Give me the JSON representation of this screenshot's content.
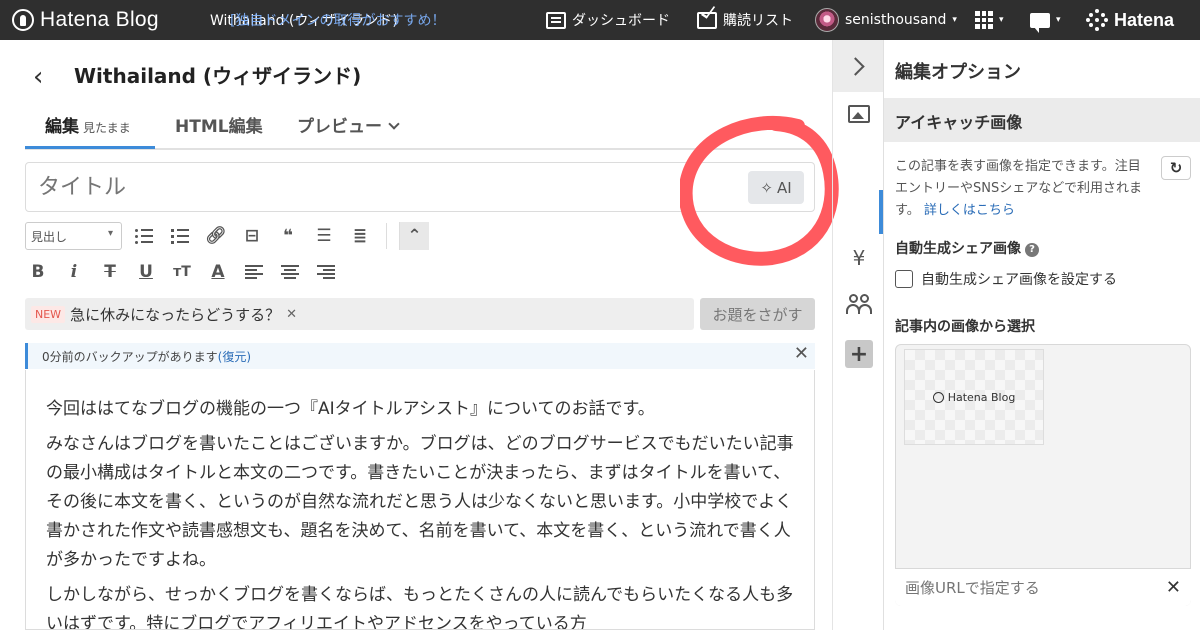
{
  "topbar": {
    "logo_text": "Hatena Blog",
    "blog_name": "Withailand (ウィザイランド)",
    "notice": "[独自ドメインの取得がおすすめ！",
    "dashboard": "ダッシュボード",
    "reading_list": "購読リスト",
    "username": "senisthousand",
    "hatena": "Hatena"
  },
  "editor": {
    "post_title": "Withailand (ウィザイランド)",
    "tabs": [
      {
        "label": "編集",
        "sub": "見たまま"
      },
      {
        "label": "HTML編集"
      },
      {
        "label": "プレビュー"
      }
    ],
    "title_placeholder": "タイトル",
    "ai_label": "AI",
    "heading_select": "見出し",
    "topic_badge": "NEW",
    "topic_text": "急に休みになったらどうする？",
    "topic_button": "お題をさがす",
    "backup_text": "0分前のバックアップがあります",
    "backup_restore": "(復元)",
    "paragraphs": [
      "今回ははてなブログの機能の一つ『AIタイトルアシスト』についてのお話です。",
      "みなさんはブログを書いたことはございますか。ブログは、どのブログサービスでもだいたい記事の最小構成はタイトルと本文の二つです。書きたいことが決まったら、まずはタイトルを書いて、その後に本文を書く、というのが自然な流れだと思う人は少なくないと思います。小中学校でよく書かされた作文や読書感想文も、題名を決めて、名前を書いて、本文を書く、という流れで書く人が多かったですよね。",
      "しかしながら、せっかくブログを書くならば、もっとたくさんの人に読んでもらいたくなる人も多いはずです。特にブログでアフィリエイトやアドセンスをやっている方"
    ]
  },
  "toolbar": {
    "icons": [
      "unordered-list-icon",
      "ordered-list-icon",
      "link-icon",
      "more-icon",
      "quote-icon",
      "table-of-contents-icon",
      "footnote-icon",
      "collapse-icon"
    ],
    "format_labels": {
      "bold": "B",
      "italic": "i",
      "strike": "T",
      "underline": "U",
      "size": "тT",
      "color": "A"
    }
  },
  "side_panel": {
    "title": "編集オプション",
    "section": "アイキャッチ画像",
    "description": "この記事を表す画像を指定できます。注目エントリーやSNSシェアなどで利用されます。",
    "learn_more": "詳しくはこちら",
    "auto_share_head": "自動生成シェア画像",
    "auto_share_check": "自動生成シェア画像を設定する",
    "pick_head": "記事内の画像から選択",
    "thumb_label": "Hatena Blog",
    "url_placeholder": "画像URLで指定する"
  },
  "colors": {
    "topbar": "#2f2f2f",
    "accent": "#3d8bd9",
    "annotation_circle": "#ff5a5f"
  }
}
